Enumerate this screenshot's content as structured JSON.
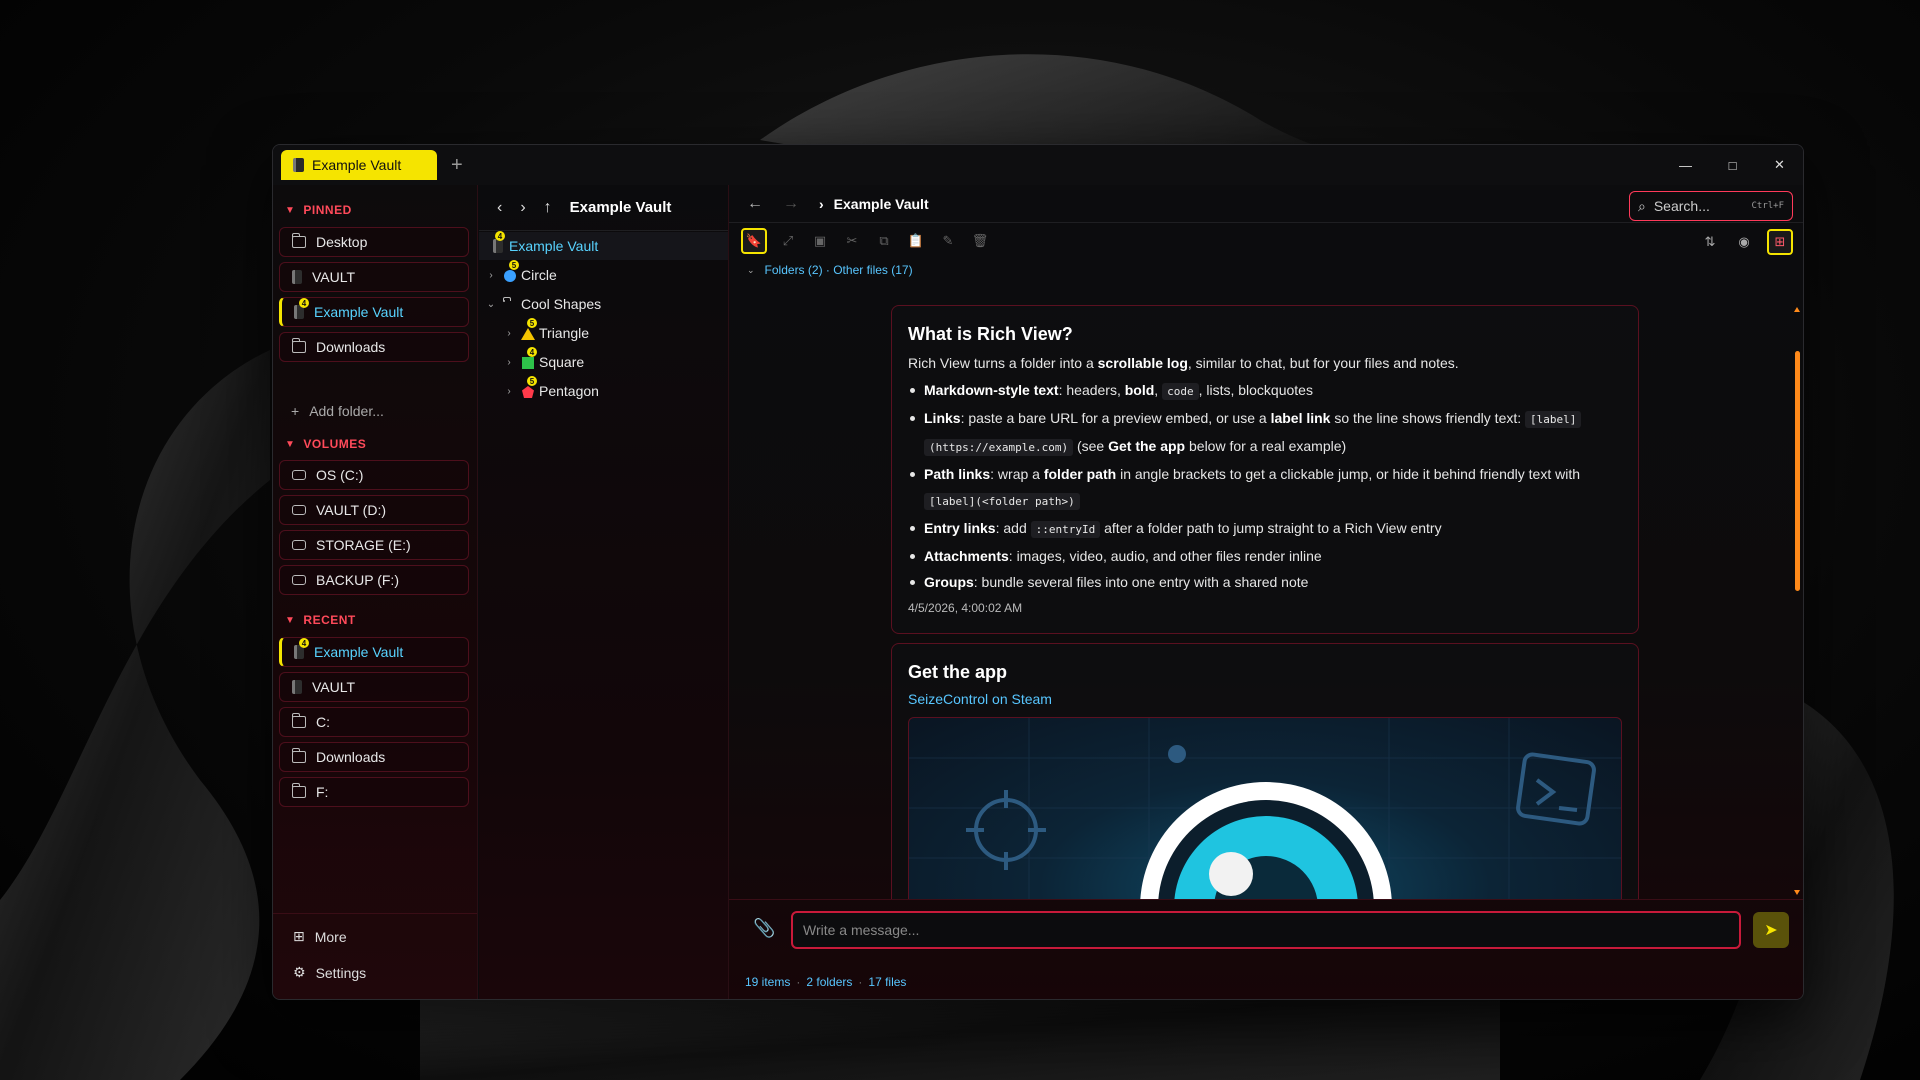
{
  "window": {
    "tab_label": "Example Vault",
    "new_tab": "+",
    "minimize": "—",
    "maximize": "□",
    "close": "✕"
  },
  "sidebar": {
    "pinned_header": "PINNED",
    "pinned": [
      {
        "label": "Desktop",
        "icon": "folder-icon"
      },
      {
        "label": "VAULT",
        "icon": "vault-icon"
      },
      {
        "label": "Example Vault",
        "icon": "vault-icon",
        "badge": "4",
        "active": true
      },
      {
        "label": "Downloads",
        "icon": "folder-icon"
      }
    ],
    "add_folder": "Add folder...",
    "volumes_header": "VOLUMES",
    "volumes": [
      {
        "label": "OS (C:)"
      },
      {
        "label": "VAULT (D:)"
      },
      {
        "label": "STORAGE (E:)"
      },
      {
        "label": "BACKUP (F:)"
      }
    ],
    "recent_header": "RECENT",
    "recent": [
      {
        "label": "Example Vault",
        "icon": "vault-icon",
        "badge": "4",
        "active": true
      },
      {
        "label": "VAULT",
        "icon": "vault-icon"
      },
      {
        "label": "C:",
        "icon": "folder-icon"
      },
      {
        "label": "Downloads",
        "icon": "folder-icon"
      },
      {
        "label": "F:",
        "icon": "folder-icon"
      }
    ],
    "more": "More",
    "settings": "Settings"
  },
  "tree": {
    "title": "Example Vault",
    "rows": [
      {
        "label": "Example Vault",
        "badge": "4",
        "selected": true
      },
      {
        "label": "Circle",
        "badge": "5"
      },
      {
        "label": "Cool Shapes"
      },
      {
        "label": "Triangle",
        "badge": "5"
      },
      {
        "label": "Square",
        "badge": "4"
      },
      {
        "label": "Pentagon",
        "badge": "5"
      }
    ]
  },
  "main": {
    "breadcrumb": "Example Vault",
    "search_placeholder": "Search...",
    "search_shortcut": "Ctrl+F",
    "filter": "Folders (2) · Other files (17)",
    "card1": {
      "title": "What is Rich View?",
      "intro_pre": "Rich View turns a folder into a ",
      "intro_bold": "scrollable log",
      "intro_post": ", similar to chat, but for your files and notes.",
      "b1_bold": "Markdown-style text",
      "b1_a": ": headers, ",
      "b1_bold2": "bold",
      "b1_b": ", ",
      "b1_code": "code",
      "b1_c": ", lists, blockquotes",
      "b2_bold": "Links",
      "b2_a": ": paste a bare URL for a preview embed, or use a ",
      "b2_bold2": "label link",
      "b2_b": " so the line shows friendly text: ",
      "b2_code": "[label]",
      "b2_code2": "(https://example.com)",
      "b2_c": " (see ",
      "b2_bold3": "Get the app",
      "b2_d": " below for a real example)",
      "b3_bold": "Path links",
      "b3_a": ": wrap a ",
      "b3_bold2": "folder path",
      "b3_b": " in angle brackets to get a clickable jump, or hide it behind friendly text with",
      "b3_code": "[label](<folder path>)",
      "b4_bold": "Entry links",
      "b4_a": ": add ",
      "b4_code": "::entryId",
      "b4_b": " after a folder path to jump straight to a Rich View entry",
      "b5_bold": "Attachments",
      "b5_a": ": images, video, audio, and other files render inline",
      "b6_bold": "Groups",
      "b6_a": ": bundle several files into one entry with a shared note",
      "timestamp": "4/5/2026, 4:00:02 AM"
    },
    "card2": {
      "title": "Get the app",
      "link": "SeizeControl on Steam"
    },
    "composer_placeholder": "Write a message...",
    "status": {
      "items": "19 items",
      "folders": "2 folders",
      "files": "17 files"
    }
  },
  "colors": {
    "accent_yellow": "#f5e400",
    "accent_red": "#ff3a5a",
    "link_blue": "#58c6ff",
    "scroll_orange": "#ff8a1a"
  }
}
